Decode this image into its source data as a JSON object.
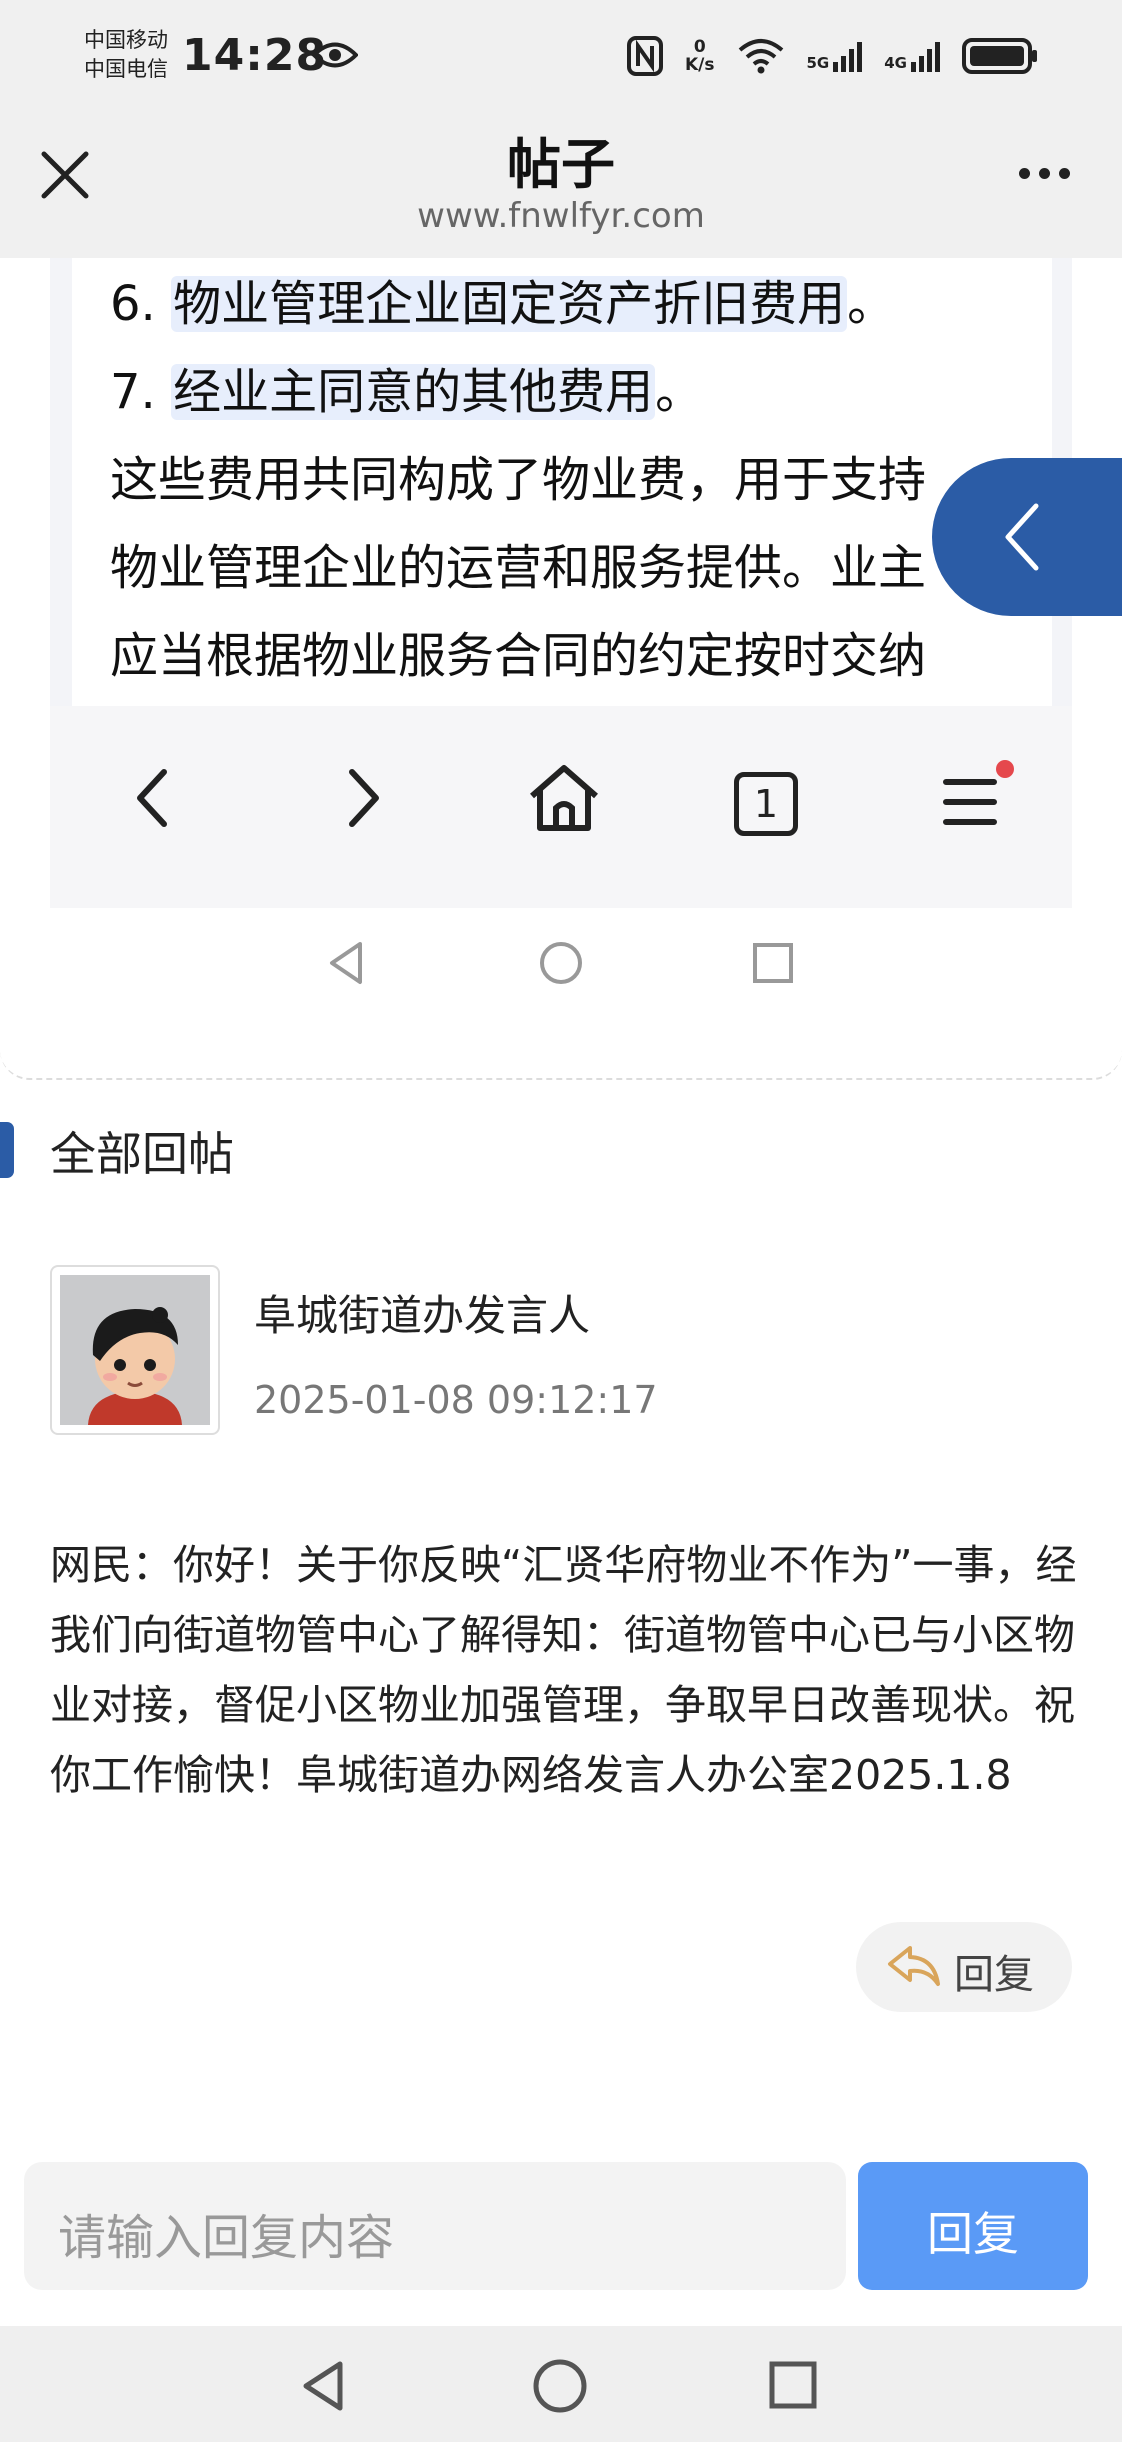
{
  "status_bar": {
    "carrier_1": "中国移动",
    "carrier_2": "中国电信",
    "time": "14:28",
    "net_speed_value": "0",
    "net_speed_unit": "K/s",
    "signal_1_tag": "5G",
    "signal_2_tag": "4G"
  },
  "title_bar": {
    "title": "帖子",
    "url": "www.fnwlfyr.com"
  },
  "screenshot": {
    "lines": [
      {
        "prefix": "6. ",
        "text": "物业管理企业固定资产折旧费用",
        "suffix": "。"
      },
      {
        "prefix": "7. ",
        "text": "经业主同意的其他费用",
        "suffix": "。"
      },
      {
        "prefix": "",
        "text": "这些费用共同构成了物业费，用于支持",
        "suffix": ""
      },
      {
        "prefix": "",
        "text": "物业管理企业的运营和服务提供。业主",
        "suffix": ""
      },
      {
        "prefix": "",
        "text": "应当根据物业服务合同的约定按时交纳",
        "suffix": ""
      }
    ],
    "tab_count": "1"
  },
  "replies": {
    "section_title": "全部回帖",
    "items": [
      {
        "author": "阜城街道办发言人",
        "time": "2025-01-08 09:12:17",
        "body": "网民：你好！关于你反映“汇贤华府物业不作为”一事，经我们向街道物管中心了解得知：街道物管中心已与小区物业对接，督促小区物业加强管理，争取早日改善现状。祝你工作愉快！阜城街道办网络发言人办公室2025.1.8",
        "reply_label": "回复"
      }
    ]
  },
  "composer": {
    "placeholder": "请输入回复内容",
    "send_label": "回复"
  },
  "colors": {
    "accent": "#2b5ca6",
    "send_button": "#5a9af6",
    "highlight": "#e7eefc",
    "badge": "#e5484d"
  }
}
